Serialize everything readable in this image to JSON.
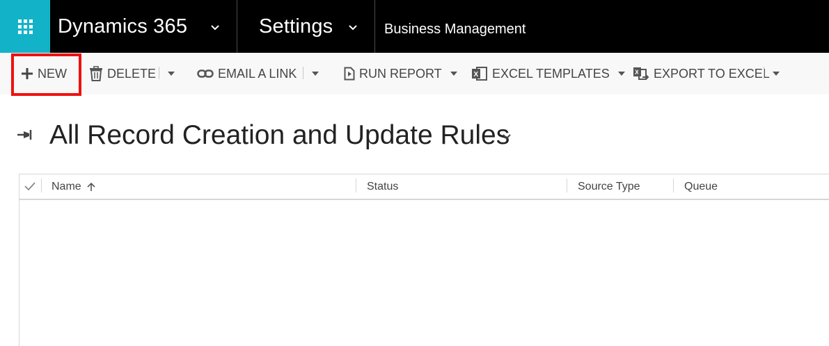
{
  "nav": {
    "app_launcher_icon": "waffle-grid-icon",
    "app_name": "Dynamics 365",
    "area_name": "Settings",
    "page_name": "Business Management"
  },
  "commands": {
    "new": "NEW",
    "delete": "DELETE",
    "email_link": "EMAIL A LINK",
    "run_report": "RUN REPORT",
    "excel_templates": "EXCEL TEMPLATES",
    "export_excel": "EXPORT TO EXCEL"
  },
  "view": {
    "title": "All Record Creation and Update Rules"
  },
  "grid": {
    "columns": [
      "Name",
      "Status",
      "Source Type",
      "Queue"
    ],
    "sorted_column": "Name",
    "sort_direction": "ascending",
    "rows": []
  },
  "colors": {
    "topbar": "#000000",
    "launcher": "#12b3c8",
    "highlight": "#ee1111",
    "commandbar": "#f8f8f8"
  }
}
